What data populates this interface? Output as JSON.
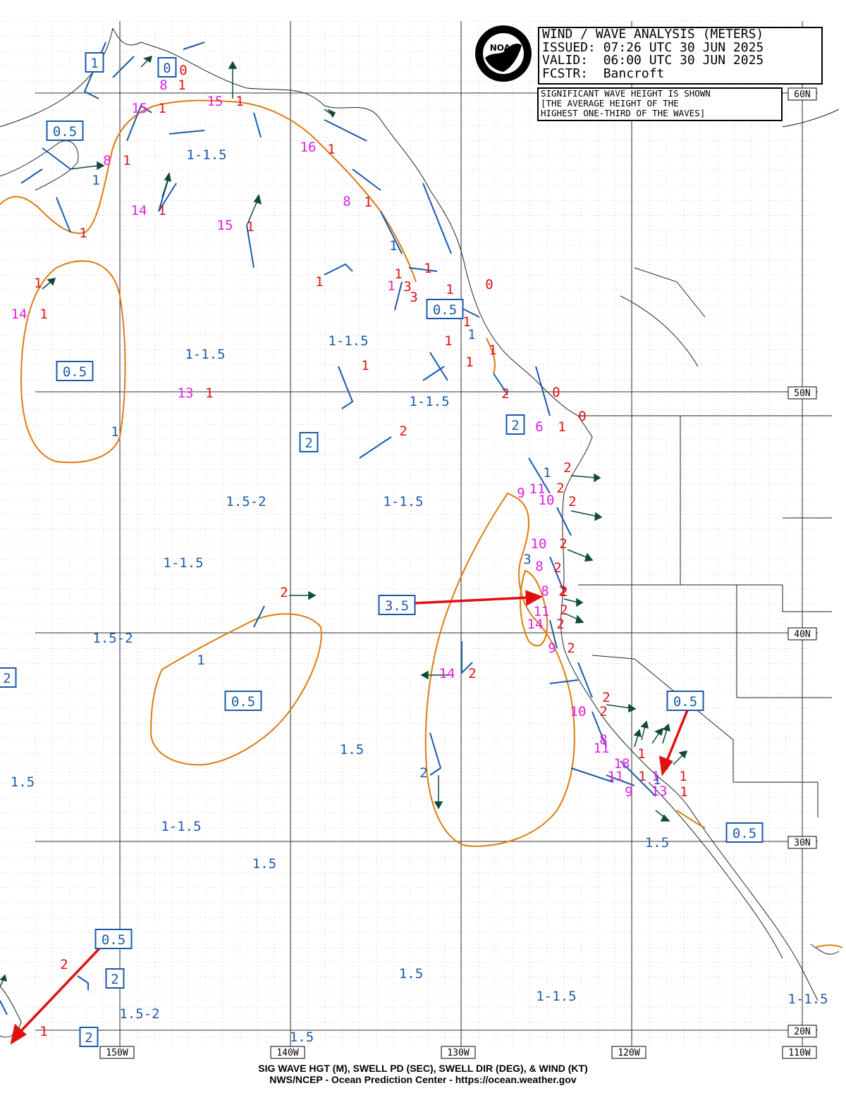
{
  "header": {
    "title": "WIND / WAVE ANALYSIS (METERS)",
    "issued": "ISSUED: 07:26 UTC 30 JUN 2025",
    "valid": "VALID:  06:00 UTC 30 JUN 2025",
    "forecaster": "FCSTR:  Bancroft"
  },
  "note": {
    "line1": "SIGNIFICANT WAVE HEIGHT IS SHOWN",
    "line2": "[THE AVERAGE HEIGHT OF THE",
    "line3": "HIGHEST ONE-THIRD OF THE WAVES]"
  },
  "logo": {
    "text": "NOAA"
  },
  "footer": {
    "line1": "SIG WAVE HGT (M), SWELL PD (SEC), SWELL DIR (DEG), & WIND (KT)",
    "line2": "NWS/NCEP - Ocean Prediction Center - https://ocean.weather.gov"
  },
  "lat_labels": [
    "60N",
    "50N",
    "40N",
    "30N",
    "20N"
  ],
  "lon_labels": [
    "150W",
    "140W",
    "130W",
    "120W",
    "110W"
  ],
  "boxed_labels": [
    "1",
    "0",
    "0.5",
    "0.5",
    "2",
    "0.5",
    "2",
    "3.5",
    "2",
    "0.5",
    "0.5",
    "0.5",
    "0.5",
    "2",
    "2"
  ],
  "range_labels": [
    "1-1.5",
    "1-1.5",
    "1-1.5",
    "1-1.5",
    "1.5-2",
    "1-1.5",
    "1-1.5",
    "1.5-2",
    "1.5",
    "1.5",
    "1-1.5",
    "1.5",
    "1.5",
    "1.5",
    "1-1.5",
    "1.5-2",
    "1.5",
    "1-1.5"
  ],
  "contour_labels": [
    "1",
    "1",
    "1",
    "1",
    "1",
    "1",
    "3",
    "2",
    "1"
  ],
  "swell_periods": [
    "8",
    "15",
    "15",
    "8",
    "16",
    "14",
    "15",
    "8",
    "14",
    "13",
    "1",
    "6",
    "9",
    "11",
    "10",
    "10",
    "8",
    "8",
    "11",
    "14",
    "9",
    "14",
    "10",
    "8",
    "11",
    "18",
    "11",
    "13",
    "9",
    "1"
  ],
  "wave_heights": [
    "0",
    "1",
    "1",
    "1",
    "1",
    "1",
    "1",
    "1",
    "1",
    "1",
    "1",
    "1",
    "1",
    "3",
    "3",
    "1",
    "0",
    "1",
    "1",
    "1",
    "1",
    "1",
    "2",
    "0",
    "1",
    "0",
    "2",
    "2",
    "2",
    "2",
    "2",
    "2",
    "2",
    "2",
    "2",
    "2",
    "2",
    "2",
    "2",
    "1",
    "2",
    "1",
    "1",
    "1",
    "1",
    "1",
    "1",
    "1",
    "1",
    "2",
    "2"
  ],
  "colors": {
    "wave_label": "#1a5aa8",
    "period_label": "#e020e0",
    "height_label": "#dd1111",
    "contour": "#e07a10",
    "wind_barb": "#1a5aa8",
    "swell_arrow": "#0f4a3a",
    "red_arrow": "#e01010"
  }
}
